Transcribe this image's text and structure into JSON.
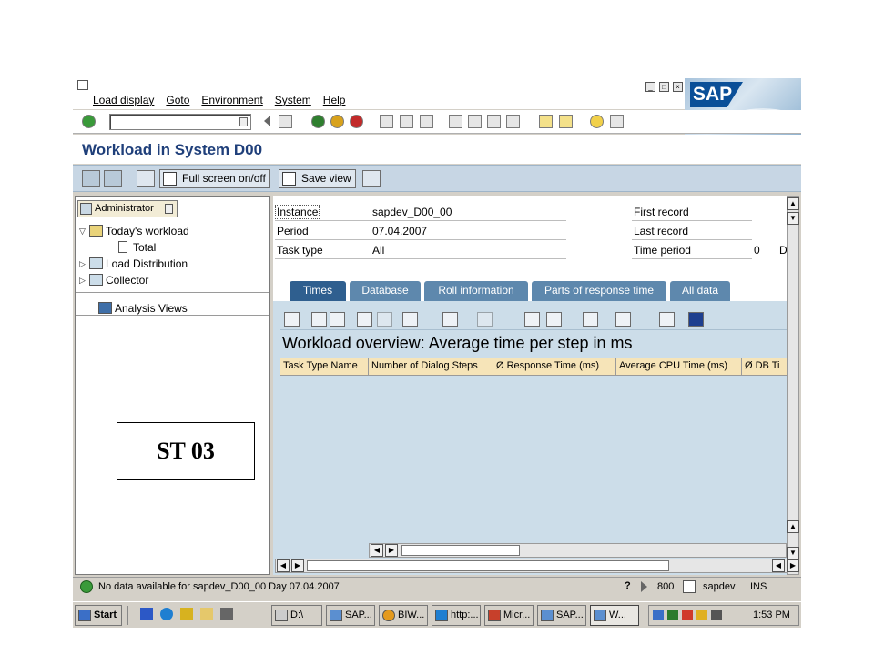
{
  "menu": {
    "items": [
      "Load display",
      "Goto",
      "Environment",
      "System",
      "Help"
    ]
  },
  "brand": {
    "logo_text": "SAP",
    "color": "#0a4f98"
  },
  "title": {
    "text": "Workload in System D00"
  },
  "app_toolbar": {
    "full_screen": "Full screen on/off",
    "save_view": "Save view"
  },
  "left_panel": {
    "header": "Administrator",
    "tree": [
      {
        "label": "Today's workload"
      },
      {
        "label": "Total"
      },
      {
        "label": "Load Distribution"
      },
      {
        "label": "Collector"
      }
    ],
    "analysis_views": "Analysis Views",
    "overlay_label": "ST 03"
  },
  "info": {
    "instance_label": "Instance",
    "instance_value": "sapdev_D00_00",
    "period_label": "Period",
    "period_value": "07.04.2007",
    "task_type_label": "Task type",
    "task_type_value": "All",
    "first_record_label": "First record",
    "last_record_label": "Last record",
    "time_period_label": "Time period",
    "time_period_value": "0",
    "cut_char": "D"
  },
  "tabs": [
    {
      "label": "Times",
      "active": true
    },
    {
      "label": "Database"
    },
    {
      "label": "Roll information"
    },
    {
      "label": "Parts of response time"
    },
    {
      "label": "All data"
    }
  ],
  "grid": {
    "title": "Workload overview: Average time per step in ms",
    "columns": [
      "Task Type Name",
      "Number of Dialog Steps",
      "Ø Response Time (ms)",
      "Average CPU Time (ms)",
      "Ø DB Ti"
    ]
  },
  "status": {
    "message": "No data available for sapdev_D00_00 Day 07.04.2007",
    "client": "800",
    "server": "sapdev",
    "mode": "INS"
  },
  "taskbar": {
    "start": "Start",
    "buttons": [
      "D:\\",
      "SAP...",
      "BIW...",
      "http:...",
      "Micr...",
      "SAP...",
      "W..."
    ],
    "clock": "1:53 PM"
  },
  "colors": {
    "title": "#1f3f7a",
    "tab_active": "#2f5f8f",
    "tab": "#5e88ad",
    "panel": "#ccdde9",
    "grid_header": "#f6e4b8"
  }
}
